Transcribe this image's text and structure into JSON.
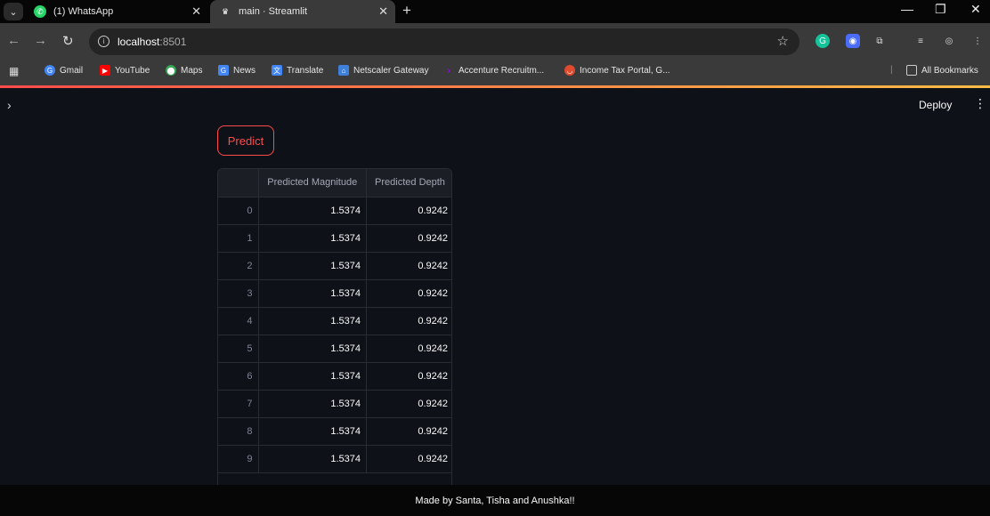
{
  "browser": {
    "tabs": [
      {
        "title": "(1) WhatsApp",
        "icon": "whatsapp-icon"
      },
      {
        "title": "main · Streamlit",
        "icon": "streamlit-icon"
      }
    ],
    "url_host": "localhost",
    "url_port": ":8501",
    "bookmarks": [
      {
        "label": "Gmail",
        "icon": "gmail-icon",
        "color": "#4285f4"
      },
      {
        "label": "YouTube",
        "icon": "youtube-icon",
        "color": "#ff0000"
      },
      {
        "label": "Maps",
        "icon": "maps-icon",
        "color": "#34a853"
      },
      {
        "label": "News",
        "icon": "news-icon",
        "color": "#4285f4"
      },
      {
        "label": "Translate",
        "icon": "translate-icon",
        "color": "#4285f4"
      },
      {
        "label": "Netscaler Gateway",
        "icon": "netscaler-icon",
        "color": "#3d7fd9"
      },
      {
        "label": "Accenture Recruitm...",
        "icon": "accenture-icon",
        "color": "#a100ff"
      },
      {
        "label": "Income Tax Portal, G...",
        "icon": "income-tax-icon",
        "color": "#e04a2f"
      }
    ],
    "all_bookmarks": "All Bookmarks"
  },
  "app": {
    "deploy_label": "Deploy",
    "predict_label": "Predict",
    "table": {
      "columns": [
        "",
        "Predicted Magnitude",
        "Predicted Depth"
      ],
      "rows": [
        [
          "0",
          "1.5374",
          "0.9242"
        ],
        [
          "1",
          "1.5374",
          "0.9242"
        ],
        [
          "2",
          "1.5374",
          "0.9242"
        ],
        [
          "3",
          "1.5374",
          "0.9242"
        ],
        [
          "4",
          "1.5374",
          "0.9242"
        ],
        [
          "5",
          "1.5374",
          "0.9242"
        ],
        [
          "6",
          "1.5374",
          "0.9242"
        ],
        [
          "7",
          "1.5374",
          "0.9242"
        ],
        [
          "8",
          "1.5374",
          "0.9242"
        ],
        [
          "9",
          "1.5374",
          "0.9242"
        ]
      ]
    },
    "footer": "Made by Santa, Tisha and Anushka!!"
  },
  "colors": {
    "accent": "#ff4b4b",
    "background": "#0e1117"
  }
}
